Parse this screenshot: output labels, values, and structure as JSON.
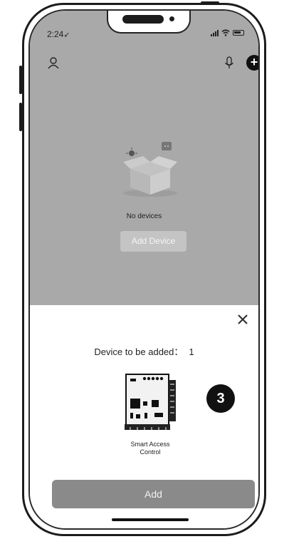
{
  "status_bar": {
    "time": "2:24",
    "location_glyph": "➶"
  },
  "header": {
    "user_icon": "user-icon",
    "mic_icon": "microphone-icon",
    "add_icon": "plus-circle-icon",
    "add_glyph": "+"
  },
  "empty_state": {
    "message": "No devices",
    "add_device_label": "Add Device"
  },
  "sheet": {
    "close_glyph": "✕",
    "title": "Device to be added：",
    "count": "1",
    "device_name_line1": "Smart Access",
    "device_name_line2": "Control",
    "add_label": "Add"
  },
  "annotation": {
    "step": "3"
  },
  "colors": {
    "overlay": "#a9a9a9",
    "primary_button": "#8a8a8a",
    "badge": "#111111"
  }
}
